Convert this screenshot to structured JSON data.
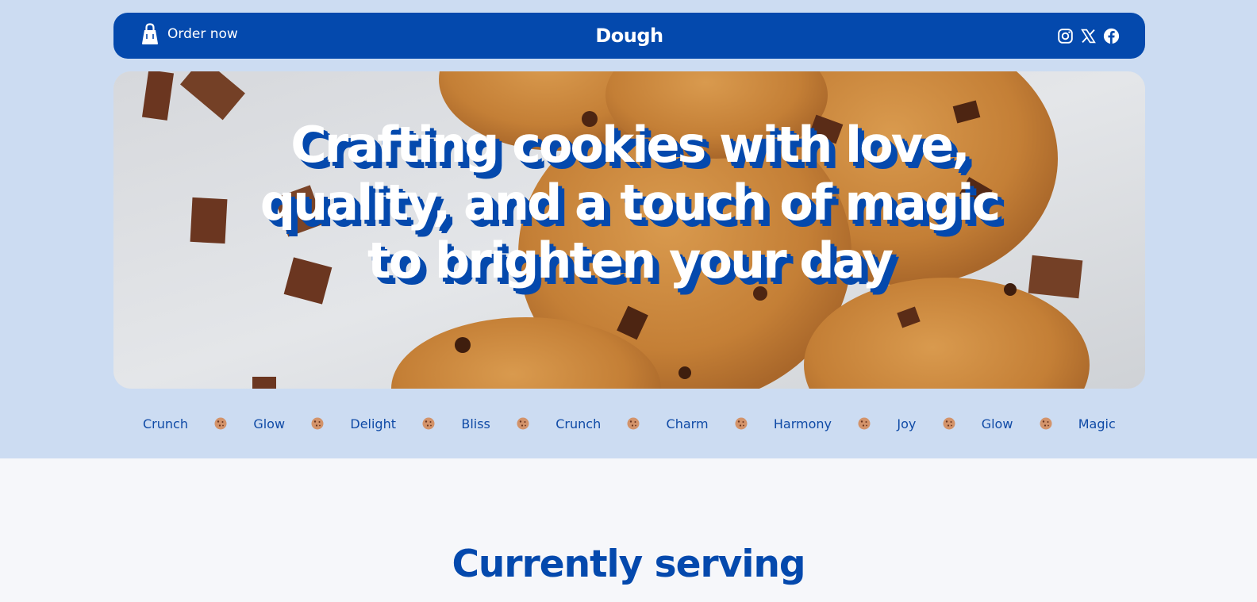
{
  "nav": {
    "order_label": "Order now",
    "brand": "Dough",
    "socials": [
      "instagram-icon",
      "x-icon",
      "facebook-icon"
    ]
  },
  "hero": {
    "headline": "Crafting cookies with love, quality, and a touch of magic to brighten your day"
  },
  "ticker": {
    "words": [
      "Crunch",
      "Glow",
      "Delight",
      "Bliss",
      "Crunch",
      "Charm",
      "Harmony",
      "Joy",
      "Glow",
      "Magic"
    ],
    "separator_icon": "cookie-icon"
  },
  "section": {
    "title": "Currently serving"
  },
  "colors": {
    "brand_blue": "#0449ad",
    "light_blue_bg": "#ccdcf2",
    "page_bg": "#f6f7fa"
  }
}
